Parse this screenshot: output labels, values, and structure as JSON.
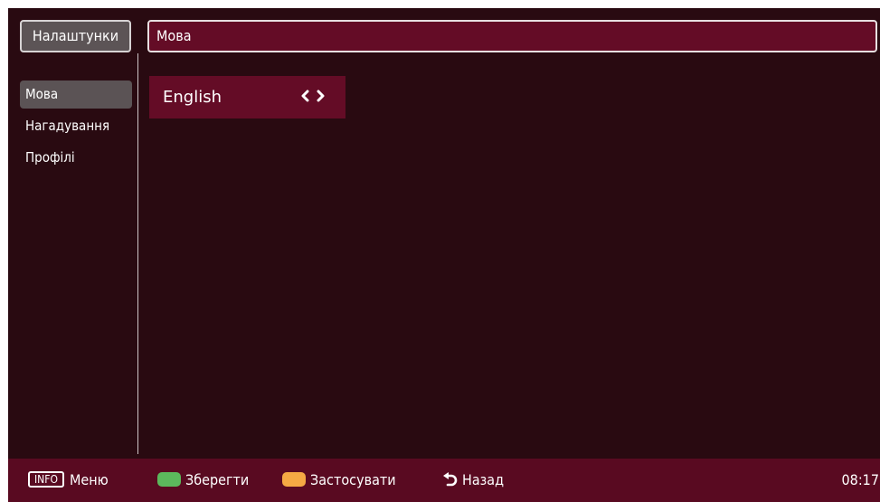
{
  "header": {
    "section_title": "Налаштунки",
    "page_title": "Мова"
  },
  "sidebar": {
    "items": [
      {
        "label": "Мова",
        "selected": true
      },
      {
        "label": "Нагадування",
        "selected": false
      },
      {
        "label": "Профілі",
        "selected": false
      }
    ]
  },
  "content": {
    "language_option": {
      "value": "English",
      "arrows": "‹›"
    }
  },
  "footer": {
    "info_key": "INFO",
    "menu_label": "Меню",
    "save_label": "Зберегти",
    "apply_label": "Застосувати",
    "back_label": "Назад",
    "clock": "08:17"
  },
  "colors": {
    "background": "#290a11",
    "accent": "#640c26",
    "footer": "#590a21",
    "green_key": "#5cb85c",
    "orange_key": "#f5a944"
  }
}
